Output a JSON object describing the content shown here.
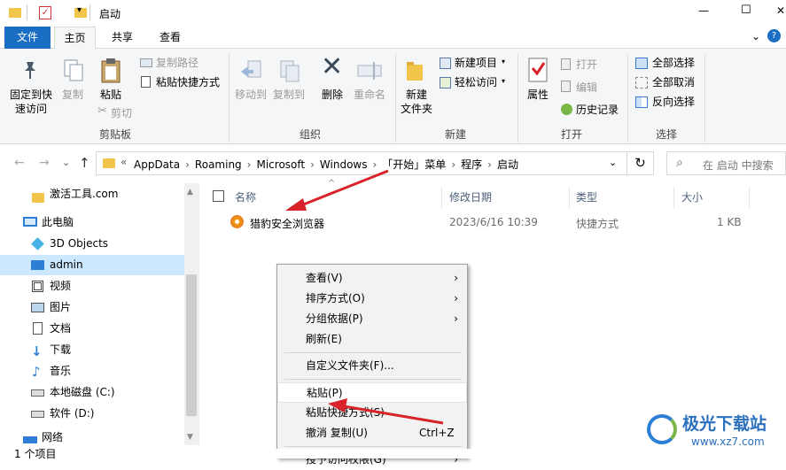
{
  "window": {
    "title": "启动",
    "minimize_glyph": "—",
    "maximize_glyph": "☐",
    "close_glyph": "✕",
    "qa_dropdown_glyph": "▾"
  },
  "ribbon_tabs": [
    "文件",
    "主页",
    "共享",
    "查看"
  ],
  "ribbon_collapse_glyph": "⌄",
  "help_glyph": "?",
  "ribbon": {
    "pin_quick_access": "固定到快\n速访问",
    "copy": "复制",
    "paste": "粘贴",
    "copy_path": "复制路径",
    "paste_shortcut": "粘贴快捷方式",
    "cut": "剪切",
    "group_clipboard": "剪贴板",
    "move_to": "移动到",
    "copy_to": "复制到",
    "delete": "删除",
    "rename": "重命名",
    "group_organize": "组织",
    "new_folder": "新建\n文件夹",
    "new_item": "新建项目",
    "easy_access": "轻松访问",
    "group_new": "新建",
    "properties": "属性",
    "open": "打开",
    "edit": "编辑",
    "history": "历史记录",
    "group_open": "打开",
    "select_all": "全部选择",
    "select_none": "全部取消",
    "invert_selection": "反向选择",
    "group_select": "选择"
  },
  "address": {
    "crumbs": [
      "AppData",
      "Roaming",
      "Microsoft",
      "Windows",
      "「开始」菜单",
      "程序",
      "启动"
    ],
    "prefix": "«",
    "search_placeholder": "在 启动 中搜索",
    "back_glyph": "←",
    "forward_glyph": "→",
    "history_glyph": "⌄",
    "up_glyph": "↑",
    "crumb_sep_glyph": "›",
    "address_dropdown_glyph": "⌄",
    "refresh_glyph": "↻",
    "search_glyph": "⌕"
  },
  "nav": {
    "items": [
      "激活工具.com",
      "此电脑",
      "3D Objects",
      "admin",
      "视频",
      "图片",
      "文档",
      "下载",
      "音乐",
      "本地磁盘 (C:)",
      "软件 (D:)",
      "网络"
    ],
    "scroll_up_glyph": "▲",
    "scroll_down_glyph": "▼"
  },
  "columns": {
    "name": "名称",
    "date": "修改日期",
    "type": "类型",
    "size": "大小",
    "sort_glyph": "^"
  },
  "files": [
    {
      "name": "猎豹安全浏览器",
      "date": "2023/6/16 10:39",
      "type": "快捷方式",
      "size": "1 KB"
    }
  ],
  "context_menu": {
    "items": [
      {
        "label": "查看(V)",
        "submenu": true
      },
      {
        "label": "排序方式(O)",
        "submenu": true
      },
      {
        "label": "分组依据(P)",
        "submenu": true
      },
      {
        "label": "刷新(E)",
        "submenu": false
      },
      {
        "label": "自定义文件夹(F)...",
        "submenu": false
      },
      {
        "label": "粘贴(P)",
        "submenu": false
      },
      {
        "label": "粘贴快捷方式(S)",
        "submenu": false
      },
      {
        "label": "撤消 复制(U)",
        "shortcut": "Ctrl+Z"
      },
      {
        "label": "授予访问权限(G)",
        "submenu": true
      }
    ],
    "submenu_glyph": "›"
  },
  "status": {
    "count": "1 个项目"
  },
  "watermark": {
    "text": "极光下载站",
    "url": "www.xz7.com"
  },
  "colors": {
    "accent": "#1a6fc4",
    "selected": "#cce8ff",
    "arrow": "#d9232a"
  }
}
